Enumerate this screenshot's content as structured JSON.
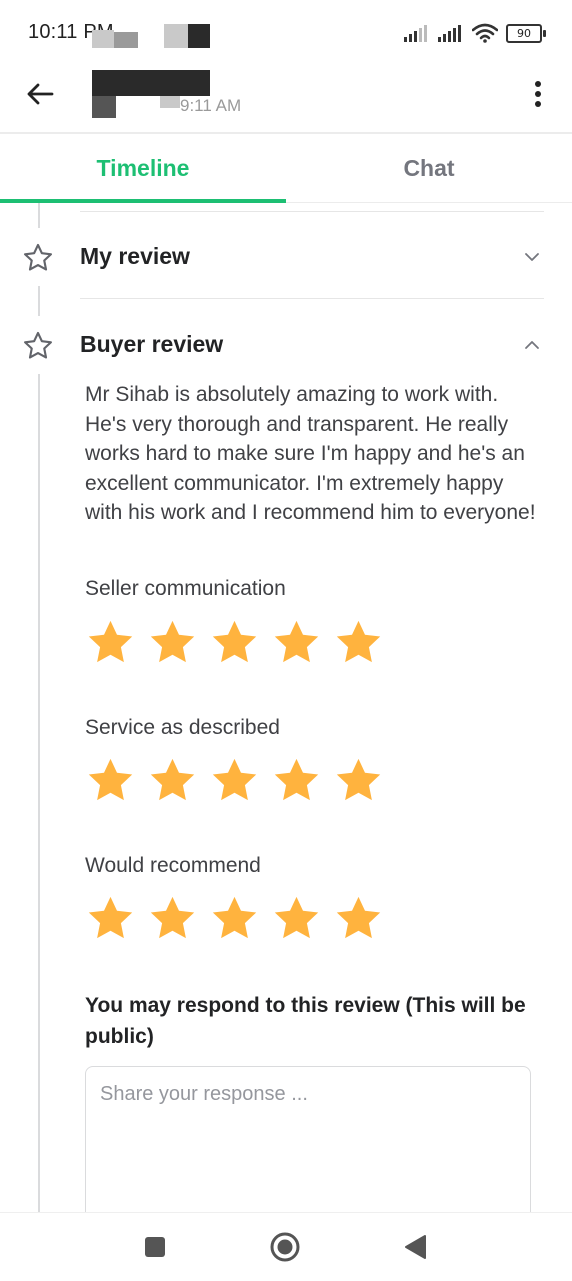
{
  "status_bar": {
    "time": "10:11 PM",
    "battery": "90"
  },
  "app_bar": {
    "subtitle": "9:11 AM"
  },
  "tabs": [
    {
      "label": "Timeline",
      "active": true
    },
    {
      "label": "Chat",
      "active": false
    }
  ],
  "sections": {
    "my_review": {
      "title": "My review",
      "expanded": false
    },
    "buyer_review": {
      "title": "Buyer review",
      "expanded": true,
      "text": "Mr Sihab is absolutely amazing to work with. He's very thorough and transparent. He really works hard to make sure I'm happy and he's an excellent communicator. I'm extremely happy with his work and I recommend him to everyone!",
      "ratings": [
        {
          "label": "Seller communication",
          "stars": 5,
          "max": 5
        },
        {
          "label": "Service as described",
          "stars": 5,
          "max": 5
        },
        {
          "label": "Would recommend",
          "stars": 5,
          "max": 5
        }
      ]
    }
  },
  "respond": {
    "prompt": "You may respond to this review (This will be public)",
    "placeholder": "Share your response ..."
  },
  "colors": {
    "accent": "#1dbf73",
    "star": "#ffb33e",
    "text": "#222325",
    "muted": "#74767e"
  },
  "icons": {
    "back": "arrow-left-icon",
    "more": "more-vert-icon",
    "section": "star-outline-icon",
    "collapse": "chevron-up-icon",
    "expand": "chevron-down-icon",
    "rating": "star-filled-icon",
    "nav_recents": "square-icon",
    "nav_home": "circle-icon",
    "nav_back": "triangle-back-icon"
  }
}
